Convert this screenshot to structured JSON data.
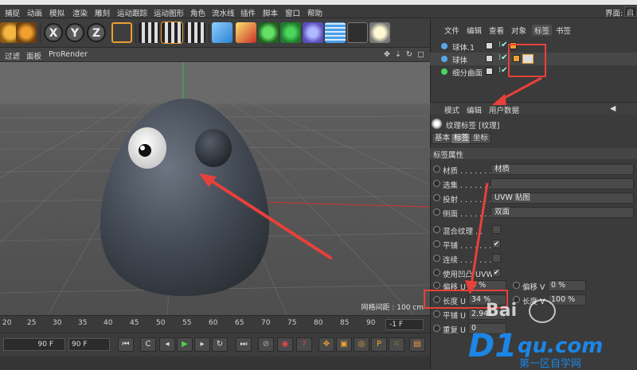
{
  "menubar": {
    "items": [
      "捕捉",
      "动画",
      "模拟",
      "渲染",
      "雕刻",
      "运动跟踪",
      "运动图形",
      "角色",
      "流水线",
      "插件",
      "脚本",
      "窗口",
      "帮助"
    ],
    "layout_label": "界面:",
    "layout_value": "启动"
  },
  "toolbar": {
    "axis_x": "X",
    "axis_y": "Y",
    "axis_z": "Z"
  },
  "viewport": {
    "menu": [
      "过滤",
      "面板",
      "ProRender"
    ],
    "grid_label": "网格间距 : 100 cm"
  },
  "timeline": {
    "ticks": [
      "20",
      "25",
      "30",
      "35",
      "40",
      "45",
      "50",
      "55",
      "60",
      "65",
      "70",
      "75",
      "80",
      "85",
      "90"
    ],
    "current_frame": "-1 F",
    "start_field": "90 F",
    "end_field": "90 F"
  },
  "object_manager": {
    "tabs": [
      "文件",
      "编辑",
      "查看",
      "对象",
      "标签",
      "书签"
    ],
    "active_tab": "标签",
    "objects": [
      {
        "name": "球体.1",
        "icon": "sphere-icon"
      },
      {
        "name": "球体",
        "icon": "sphere-icon"
      },
      {
        "name": "细分曲面",
        "icon": "subdivision-surface-icon"
      }
    ]
  },
  "attribute_manager": {
    "header": [
      "模式",
      "编辑",
      "用户数据"
    ],
    "title": "纹理标签 [纹理]",
    "tabs": [
      "基本",
      "标签",
      "坐标"
    ],
    "active_tab": "标签",
    "section": "标签属性",
    "props": {
      "material_label": "材质 . . . . . . .",
      "material_value": "材质",
      "selection_label": "选集 . . . . . . .",
      "selection_value": "",
      "projection_label": "投射 . . . . . . .",
      "projection_value": "UVW 贴图",
      "side_label": "侧面 . . . . . . .",
      "side_value": "双面",
      "mix_label": "混合纹理 . .",
      "tile_label": "平铺 . . . . . . .",
      "tile_checked": "✔",
      "seamless_label": "连续 . . . . . . .",
      "use_uvw_label": "使用凹凸 UVW",
      "use_uvw_checked": "✔",
      "offset_u_label": "偏移 U",
      "offset_u_value": "0 %",
      "offset_v_label": "偏移 V",
      "offset_v_value": "0 %",
      "length_u_label": "长度 U",
      "length_u_value": "34 %",
      "length_v_label": "长度 V",
      "length_v_value": "100 %",
      "tiles_u_label": "平铺 U",
      "tiles_u_value": "2.941",
      "repeat_u_label": "重复 U",
      "repeat_u_value": "0"
    }
  },
  "watermark": {
    "baidu": "Bai",
    "site_main": "D1",
    "site_domain": "qu.com",
    "site_sub": "第一区自学网"
  },
  "colors": {
    "annotation": "#e8413a",
    "accent": "#57a7e8"
  }
}
